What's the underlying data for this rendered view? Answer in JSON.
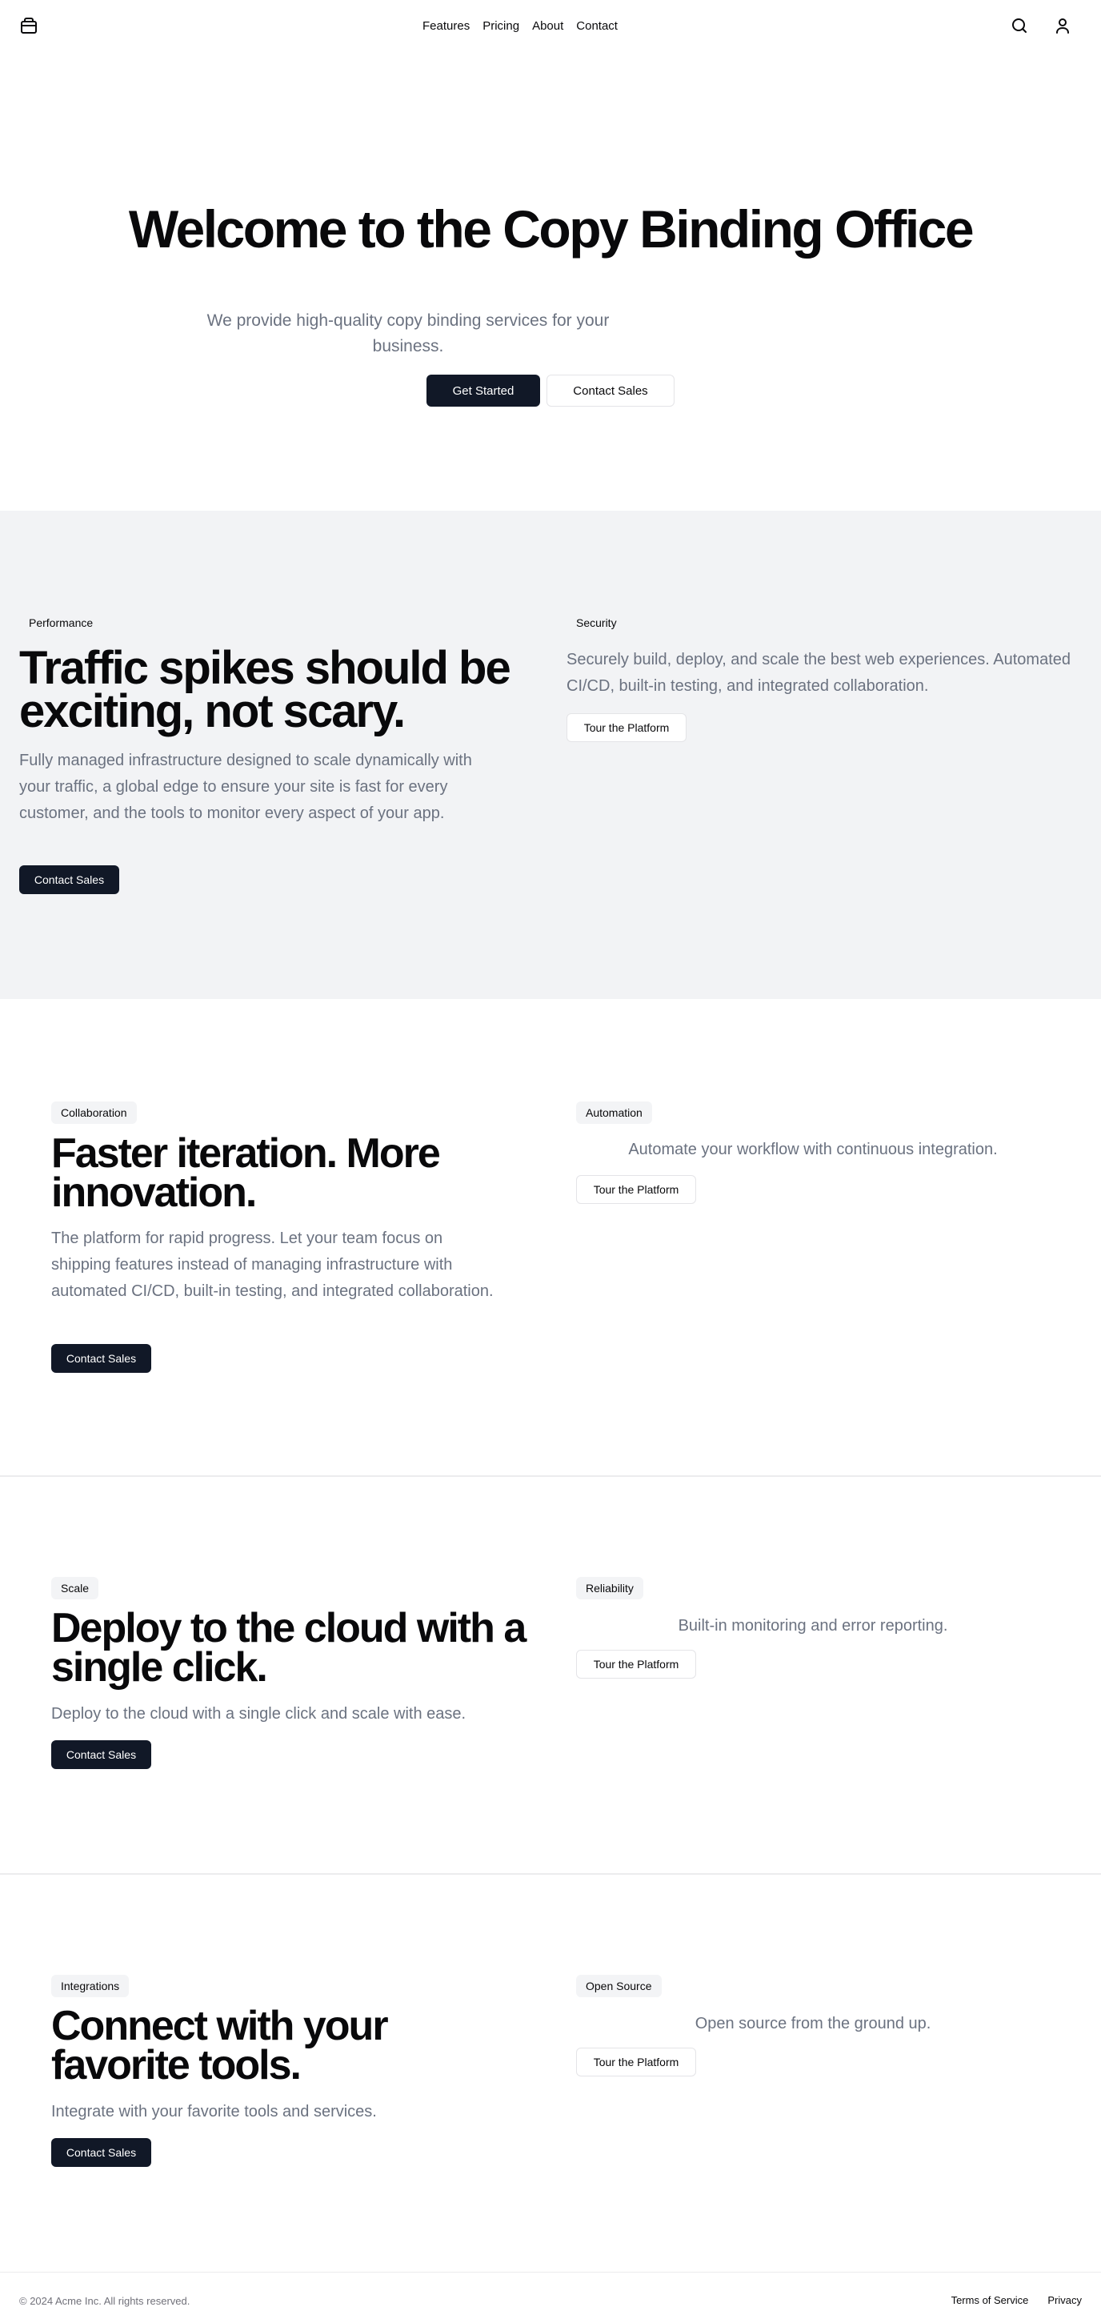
{
  "header": {
    "nav": [
      "Features",
      "Pricing",
      "About",
      "Contact"
    ]
  },
  "hero": {
    "title": "Welcome to the Copy Binding Office",
    "subtitle": "We provide high-quality copy binding services for your business.",
    "primary_button": "Get Started",
    "secondary_button": "Contact Sales"
  },
  "sections": [
    {
      "left": {
        "tag": "Performance",
        "title": "Traffic spikes should be exciting, not scary.",
        "text": "Fully managed infrastructure designed to scale dynamically with your traffic, a global edge to ensure your site is fast for every customer, and the tools to monitor every aspect of your app.",
        "button": "Contact Sales"
      },
      "right": {
        "tag": "Security",
        "text": "Securely build, deploy, and scale the best web experiences. Automated CI/CD, built-in testing, and integrated collaboration.",
        "button": "Tour the Platform"
      }
    },
    {
      "left": {
        "tag": "Collaboration",
        "title": "Faster iteration. More innovation.",
        "text": "The platform for rapid progress. Let your team focus on shipping features instead of managing infrastructure with automated CI/CD, built-in testing, and integrated collaboration.",
        "button": "Contact Sales"
      },
      "right": {
        "tag": "Automation",
        "text": "Automate your workflow with continuous integration.",
        "button": "Tour the Platform"
      }
    },
    {
      "left": {
        "tag": "Scale",
        "title": "Deploy to the cloud with a single click.",
        "text": "Deploy to the cloud with a single click and scale with ease.",
        "button": "Contact Sales"
      },
      "right": {
        "tag": "Reliability",
        "text": "Built-in monitoring and error reporting.",
        "button": "Tour the Platform"
      }
    },
    {
      "left": {
        "tag": "Integrations",
        "title": "Connect with your favorite tools.",
        "text": "Integrate with your favorite tools and services.",
        "button": "Contact Sales"
      },
      "right": {
        "tag": "Open Source",
        "text": "Open source from the ground up.",
        "button": "Tour the Platform"
      }
    }
  ],
  "footer": {
    "copyright": "© 2024 Acme Inc. All rights reserved.",
    "links": [
      "Terms of Service",
      "Privacy"
    ]
  }
}
